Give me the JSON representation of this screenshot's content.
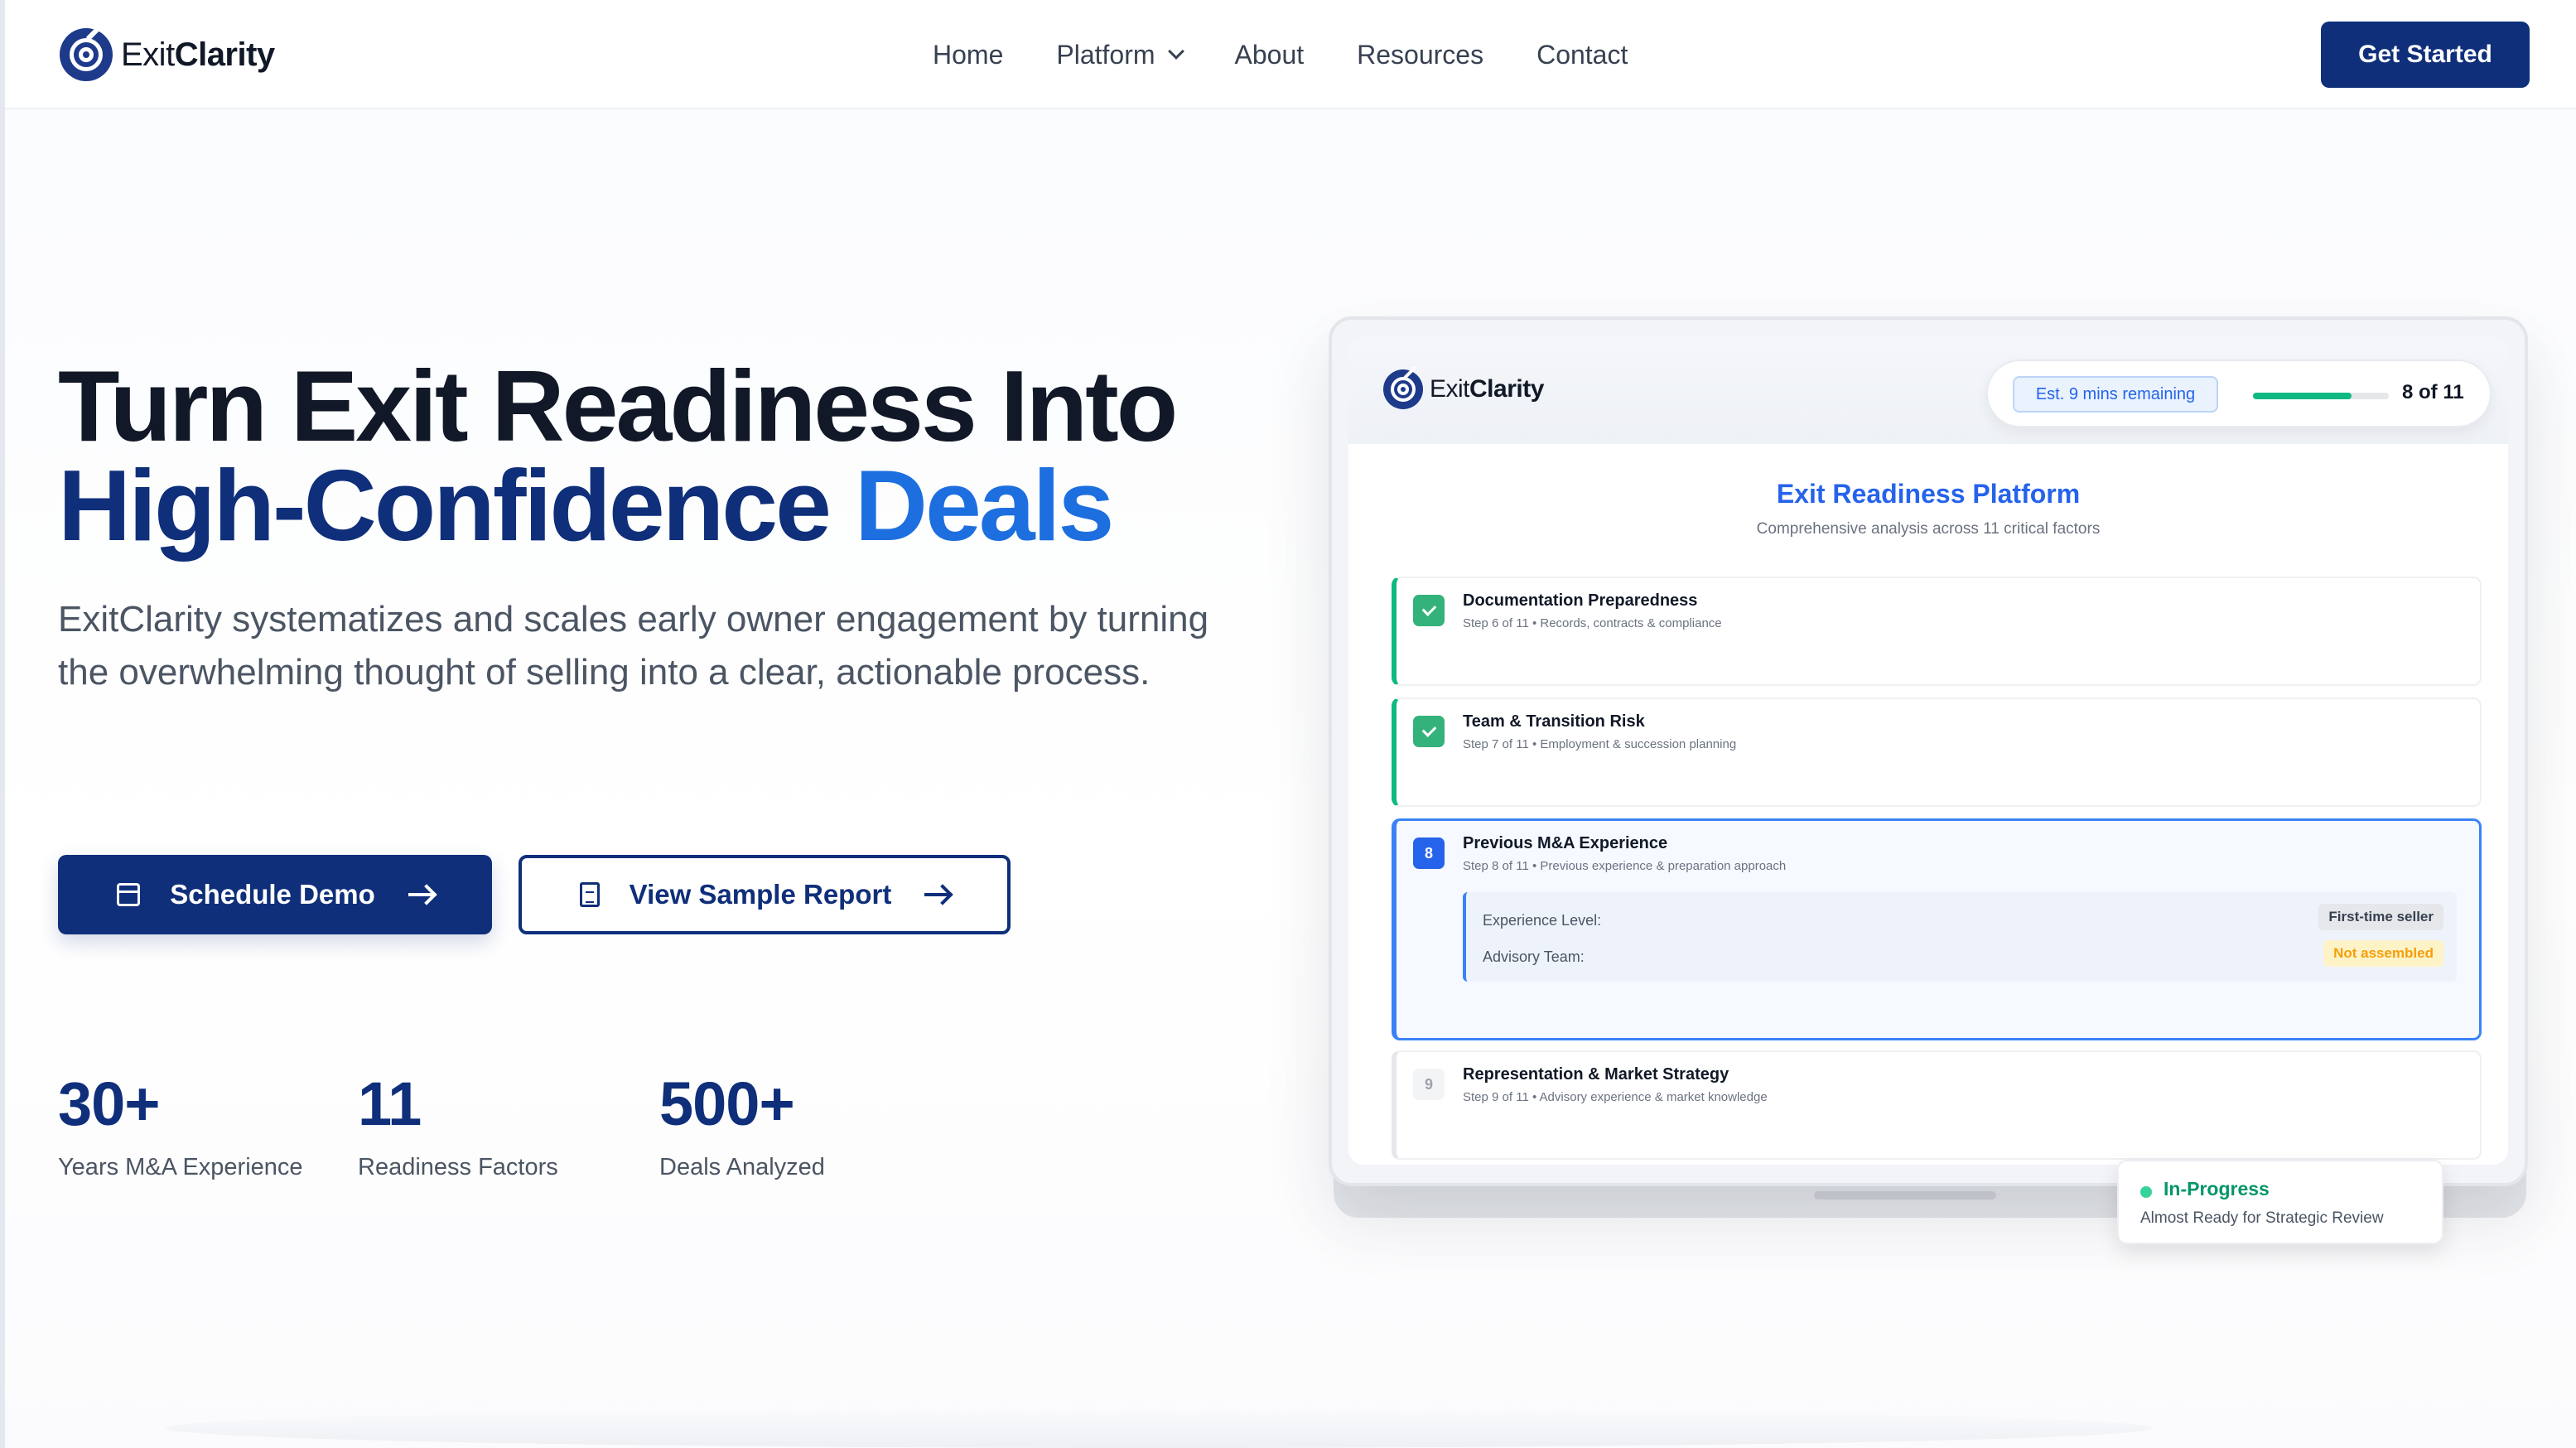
{
  "brand": {
    "name_light": "Exit",
    "name_bold": "Clarity"
  },
  "nav": {
    "links": [
      {
        "label": "Home"
      },
      {
        "label": "Platform",
        "dropdown": true
      },
      {
        "label": "About"
      },
      {
        "label": "Resources"
      },
      {
        "label": "Contact"
      }
    ],
    "cta": "Get Started"
  },
  "hero": {
    "headline_line1": "Turn Exit Readiness Into",
    "headline_line2_a": "High-Confidence ",
    "headline_line2_b": "Deals",
    "subtext": "ExitClarity systematizes and scales early owner engagement by turning the overwhelming thought of selling into a clear, actionable process.",
    "primary_button": "Schedule Demo",
    "secondary_button": "View Sample Report"
  },
  "stats": [
    {
      "value": "30+",
      "label": "Years M&A Experience"
    },
    {
      "value": "11",
      "label": "Readiness Factors"
    },
    {
      "value": "500+",
      "label": "Deals Analyzed"
    }
  ],
  "mockup": {
    "brand_light": "Exit",
    "brand_bold": "Clarity",
    "est_remaining": "Est. 9 mins remaining",
    "progress_fraction": 0.727,
    "step_count": "8 of 11",
    "title": "Exit Readiness Platform",
    "subtitle": "Comprehensive analysis across 11 critical factors",
    "steps": [
      {
        "status": "done",
        "badge": "",
        "title": "Documentation Preparedness",
        "sub": "Step 6 of 11 • Records, contracts & compliance"
      },
      {
        "status": "done",
        "badge": "",
        "title": "Team & Transition Risk",
        "sub": "Step 7 of 11 • Employment & succession planning"
      },
      {
        "status": "active",
        "badge": "8",
        "title": "Previous M&A Experience",
        "sub": "Step 8 of 11 • Previous experience & preparation approach",
        "details": [
          {
            "label": "Experience Level:",
            "value": "First-time seller"
          },
          {
            "label": "Advisory Team:",
            "value": "Not assembled"
          }
        ]
      },
      {
        "status": "pending",
        "badge": "9",
        "title": "Representation & Market Strategy",
        "sub": "Step 9 of 11 • Advisory experience & market knowledge"
      }
    ],
    "status_card": {
      "title": "In-Progress",
      "sub": "Almost Ready for Strategic Review"
    }
  },
  "colors": {
    "navy": "#0f2f7a",
    "accent_blue": "#1d6fe0",
    "success_green": "#10b981",
    "warning_orange": "#f59e0b"
  }
}
